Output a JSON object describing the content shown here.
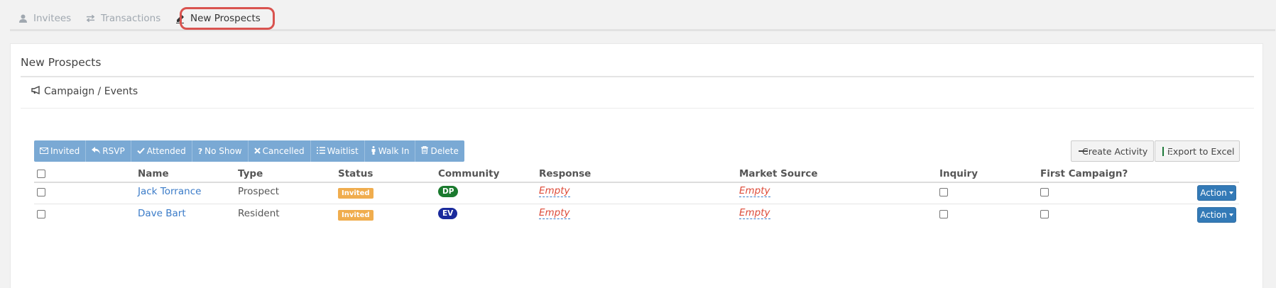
{
  "tabs": [
    {
      "label": "Invitees",
      "icon": "user-icon"
    },
    {
      "label": "Transactions",
      "icon": "exchange-icon"
    },
    {
      "label": "New Prospects",
      "icon": "pencil-icon"
    }
  ],
  "panel": {
    "title": "New Prospects",
    "section": "Campaign / Events"
  },
  "toolbar": {
    "buttons": [
      {
        "label": "Invited",
        "icon": "envelope-icon"
      },
      {
        "label": "RSVP",
        "icon": "reply-icon"
      },
      {
        "label": "Attended",
        "icon": "check-icon"
      },
      {
        "label": "No Show",
        "icon": "question-icon"
      },
      {
        "label": "Cancelled",
        "icon": "times-icon"
      },
      {
        "label": "Waitlist",
        "icon": "list-icon"
      },
      {
        "label": "Walk In",
        "icon": "walk-icon"
      },
      {
        "label": "Delete",
        "icon": "trash-icon"
      }
    ],
    "create_activity": "Create Activity",
    "export_excel": "Export to Excel"
  },
  "table": {
    "headers": {
      "name": "Name",
      "type": "Type",
      "status": "Status",
      "community": "Community",
      "response": "Response",
      "market_source": "Market Source",
      "inquiry": "Inquiry",
      "first_campaign": "First Campaign?"
    },
    "rows": [
      {
        "name": "Jack Torrance",
        "type": "Prospect",
        "status": "Invited",
        "community": "DP",
        "community_color": "#1a7a2e",
        "response": "Empty",
        "market_source": "Empty",
        "action": "Action"
      },
      {
        "name": "Dave Bart",
        "type": "Resident",
        "status": "Invited",
        "community": "EV",
        "community_color": "#1a2a9c",
        "response": "Empty",
        "market_source": "Empty",
        "action": "Action"
      }
    ]
  },
  "colors": {
    "accent": "#337ab7",
    "toolbar": "#7aa9d4",
    "status_invited": "#f0ad4e",
    "empty_text": "#dd4b39",
    "highlight": "#d9534f"
  }
}
